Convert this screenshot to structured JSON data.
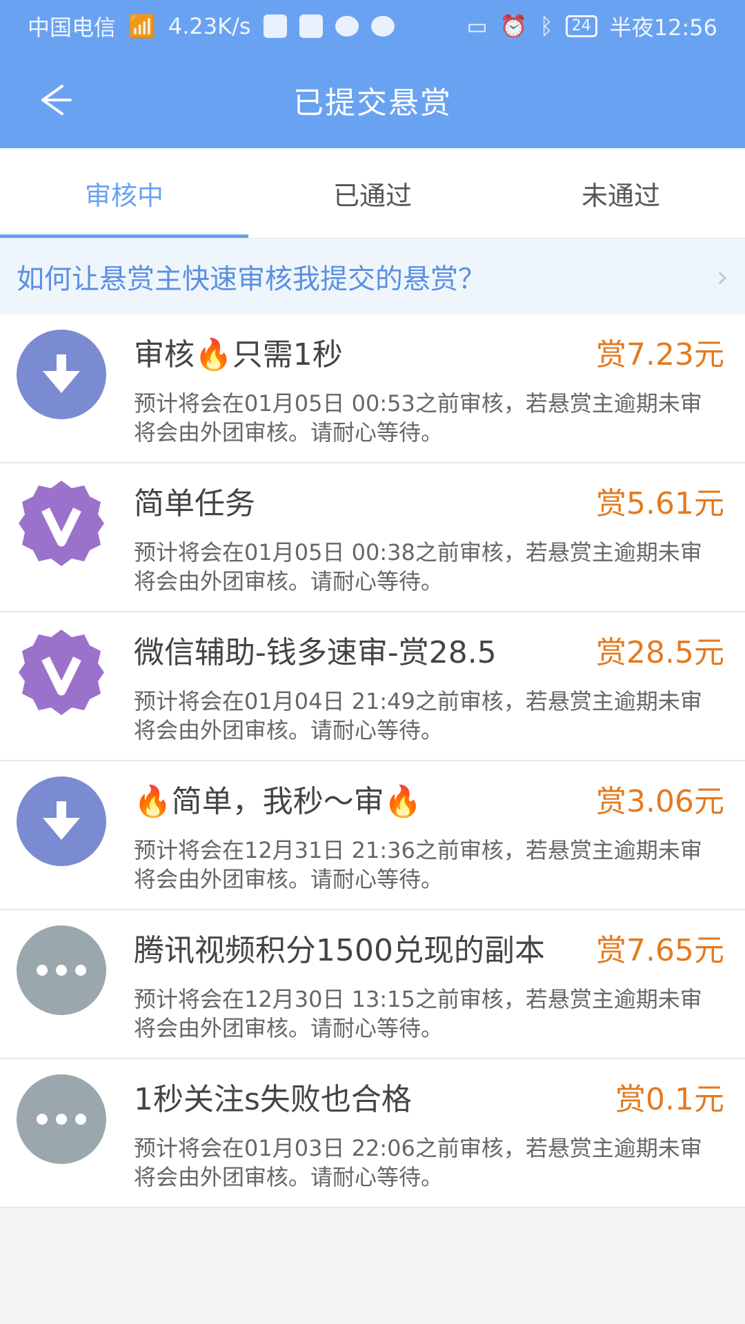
{
  "status": {
    "carrier": "中国电信",
    "net": "4.23K/s",
    "battery": "24",
    "time": "半夜12:56"
  },
  "header": {
    "title": "已提交悬赏"
  },
  "tabs": [
    {
      "label": "审核中"
    },
    {
      "label": "已通过"
    },
    {
      "label": "未通过"
    }
  ],
  "tip": {
    "text": "如何让悬赏主快速审核我提交的悬赏？"
  },
  "items": [
    {
      "name": "审核🔥只需1秒",
      "reward": "赏7.23元",
      "desc": "预计将会在01月05日 00:53之前审核，若悬赏主逾期未审将会由外团审核。请耐心等待。",
      "icon": "download-icon"
    },
    {
      "name": "简单任务",
      "reward": "赏5.61元",
      "desc": "预计将会在01月05日 00:38之前审核，若悬赏主逾期未审将会由外团审核。请耐心等待。",
      "icon": "v-badge-icon"
    },
    {
      "name": "微信辅助-钱多速审-赏28.5",
      "reward": "赏28.5元",
      "desc": "预计将会在01月04日 21:49之前审核，若悬赏主逾期未审将会由外团审核。请耐心等待。",
      "icon": "v-badge-icon"
    },
    {
      "name": "🔥简单，我秒～审🔥",
      "reward": "赏3.06元",
      "desc": "预计将会在12月31日 21:36之前审核，若悬赏主逾期未审将会由外团审核。请耐心等待。",
      "icon": "download-icon"
    },
    {
      "name": "腾讯视频积分1500兑现的副本",
      "reward": "赏7.65元",
      "desc": "预计将会在12月30日 13:15之前审核，若悬赏主逾期未审将会由外团审核。请耐心等待。",
      "icon": "more-icon"
    },
    {
      "name": "1秒关注s失败也合格",
      "reward": "赏0.1元",
      "desc": "预计将会在01月03日 22:06之前审核，若悬赏主逾期未审将会由外团审核。请耐心等待。",
      "icon": "more-icon"
    }
  ],
  "colors": {
    "primary": "#6aa2f2",
    "reward": "#e37a1f",
    "avatar_blue": "#7a8bd1",
    "avatar_purple": "#9b72cb",
    "avatar_gray": "#9aa8ae"
  }
}
